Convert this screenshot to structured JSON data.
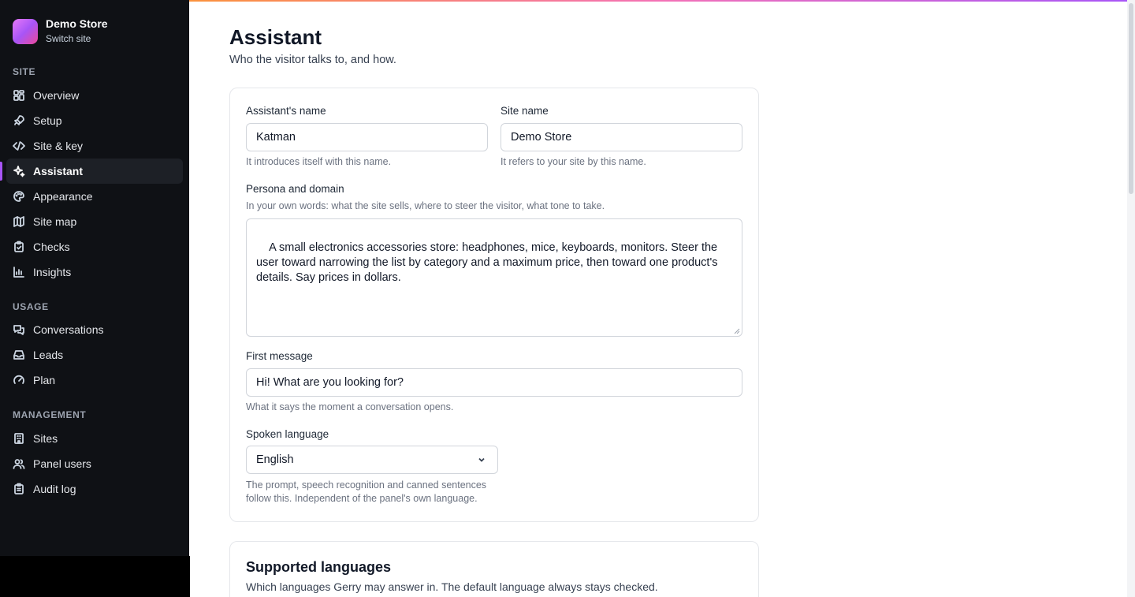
{
  "brand": {
    "name": "Demo Store",
    "switch_label": "Switch site",
    "gradient_colors": [
      "#e879f9",
      "#a855f7",
      "#ec4899"
    ]
  },
  "sidebar": {
    "sections": [
      {
        "label": "SITE",
        "items": [
          {
            "label": "Overview",
            "icon": "grid-icon"
          },
          {
            "label": "Setup",
            "icon": "rocket-icon"
          },
          {
            "label": "Site & key",
            "icon": "code-icon"
          },
          {
            "label": "Assistant",
            "icon": "sparkle-icon",
            "active": true
          },
          {
            "label": "Appearance",
            "icon": "palette-icon"
          },
          {
            "label": "Site map",
            "icon": "map-icon"
          },
          {
            "label": "Checks",
            "icon": "clipboard-check-icon"
          },
          {
            "label": "Insights",
            "icon": "bar-chart-icon"
          }
        ]
      },
      {
        "label": "USAGE",
        "items": [
          {
            "label": "Conversations",
            "icon": "chat-bubbles-icon"
          },
          {
            "label": "Leads",
            "icon": "inbox-icon"
          },
          {
            "label": "Plan",
            "icon": "gauge-icon"
          }
        ]
      },
      {
        "label": "MANAGEMENT",
        "items": [
          {
            "label": "Sites",
            "icon": "building-icon"
          },
          {
            "label": "Panel users",
            "icon": "users-icon"
          },
          {
            "label": "Audit log",
            "icon": "clipboard-list-icon"
          }
        ]
      }
    ],
    "accent_color": "#a855f7"
  },
  "page": {
    "title": "Assistant",
    "subtitle": "Who the visitor talks to, and how."
  },
  "form": {
    "assistant_name": {
      "label": "Assistant's name",
      "value": "Katman",
      "hint": "It introduces itself with this name."
    },
    "site_name": {
      "label": "Site name",
      "value": "Demo Store",
      "hint": "It refers to your site by this name."
    },
    "persona": {
      "label": "Persona and domain",
      "hint": "In your own words: what the site sells, where to steer the visitor, what tone to take.",
      "value": "A small electronics accessories store: headphones, mice, keyboards, monitors. Steer the user toward narrowing the list by category and a maximum price, then toward one product's details. Say prices in dollars."
    },
    "first_message": {
      "label": "First message",
      "value": "Hi! What are you looking for?",
      "hint": "What it says the moment a conversation opens."
    },
    "spoken_language": {
      "label": "Spoken language",
      "value": "English",
      "hint_line1": "The prompt, speech recognition and canned sentences",
      "hint_line2": "follow this. Independent of the panel's own language."
    }
  },
  "supported_languages": {
    "title": "Supported languages",
    "subtitle": "Which languages Gerry may answer in. The default language always stays checked."
  }
}
